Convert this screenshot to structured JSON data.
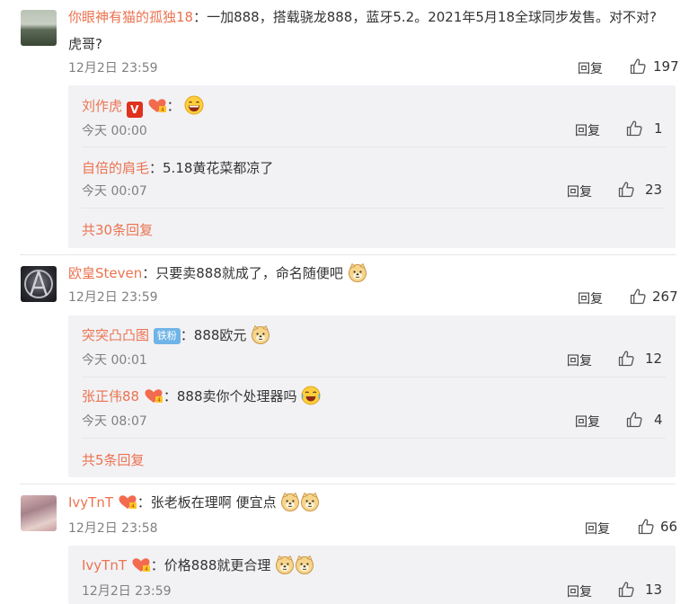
{
  "comments": [
    {
      "user": "你眼神有猫的孤独18",
      "text": "：一加888，搭载骁龙888，蓝牙5.2。2021年5月18全球同步发售。对不对?",
      "text2": "虎哥?",
      "time": "12月2日 23:59",
      "reply_label": "回复",
      "likes": "197",
      "replies": [
        {
          "user": "刘作虎",
          "text": "：",
          "time": "今天 00:00",
          "reply_label": "回复",
          "likes": "1"
        },
        {
          "user": "自倍的肩毛",
          "text": "：5.18黄花菜都凉了",
          "time": "今天 00:07",
          "reply_label": "回复",
          "likes": "23"
        }
      ],
      "more": "共30条回复"
    },
    {
      "user": "欧皇Steven",
      "text": "：只要卖888就成了，命名随便吧",
      "time": "12月2日 23:59",
      "reply_label": "回复",
      "likes": "267",
      "replies": [
        {
          "user": "突突凸凸图",
          "badge": "铁粉",
          "text": "：888欧元",
          "time": "今天 00:01",
          "reply_label": "回复",
          "likes": "12"
        },
        {
          "user": "张正伟88",
          "text": "：888卖你个处理器吗",
          "time": "今天 08:07",
          "reply_label": "回复",
          "likes": "4"
        }
      ],
      "more": "共5条回复"
    },
    {
      "user": "IvyTnT",
      "text": "：张老板在理啊  便宜点",
      "time": "12月2日 23:58",
      "reply_label": "回复",
      "likes": "66",
      "replies": [
        {
          "user": "IvyTnT",
          "text": "：价格888就更合理",
          "time": "12月2日 23:59",
          "reply_label": "回复",
          "likes": "13"
        }
      ]
    }
  ],
  "colors": {
    "username": "#eb7350",
    "reply_bg": "#f2f2f5"
  },
  "icons": [
    "thumb-up-icon",
    "verified-v-icon",
    "heart-fan-badge-icon",
    "laughing-emoji-icon",
    "doge-emoji-icon",
    "cry-laugh-emoji-icon"
  ]
}
